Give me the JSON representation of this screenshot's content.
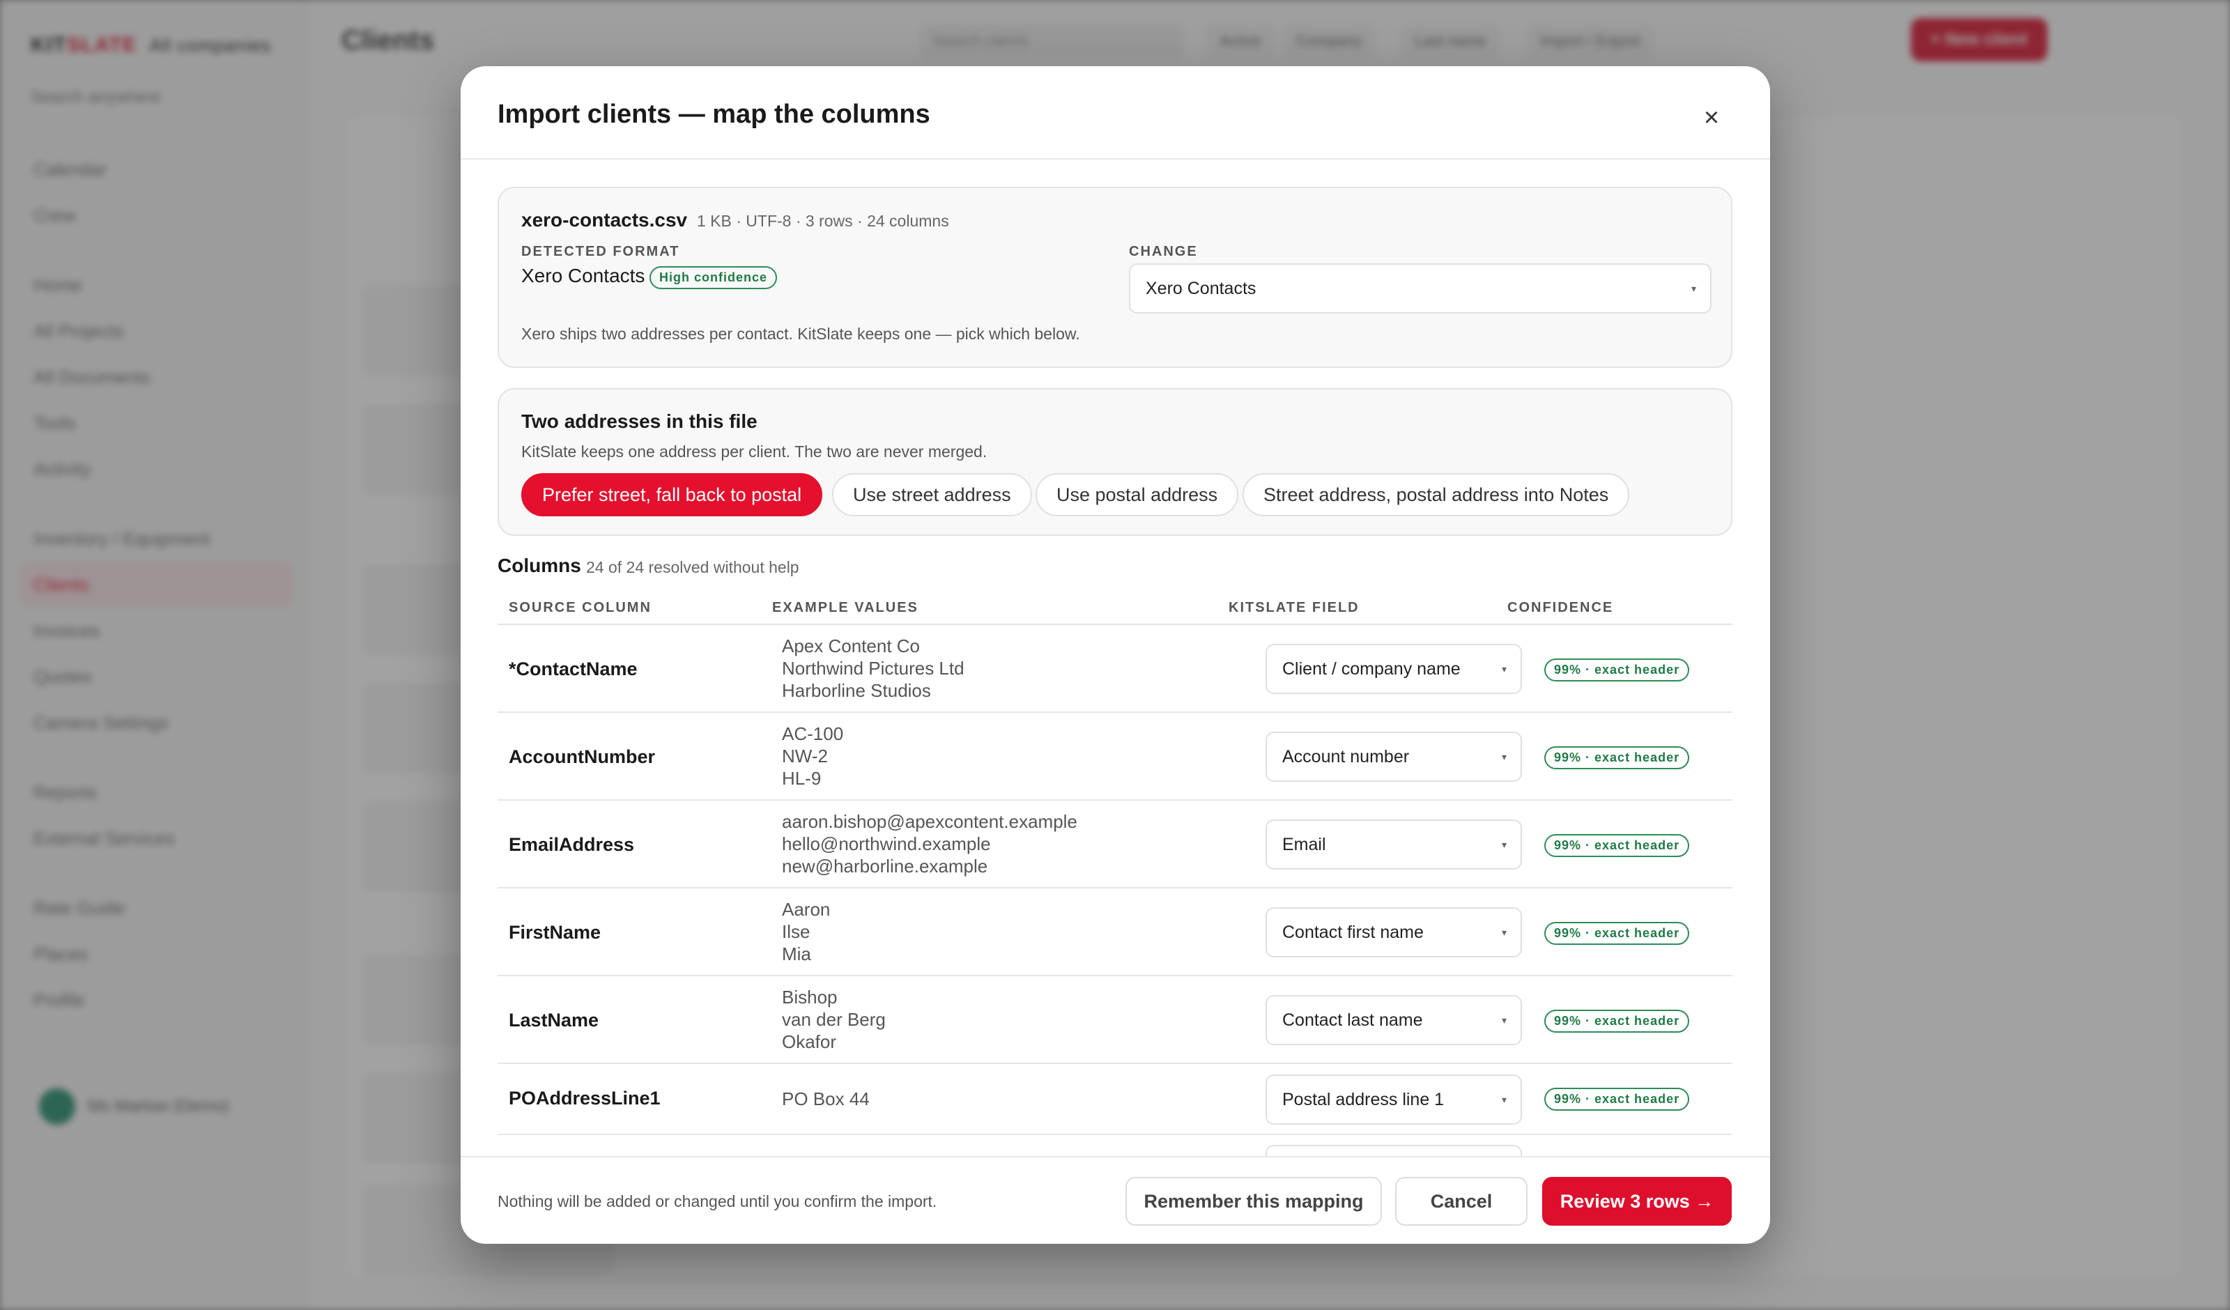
{
  "background": {
    "logo_a": "KIT",
    "logo_b": "SLATE",
    "company": "All companies",
    "search": "Search anywhere",
    "page_title": "Clients",
    "top_search": "Search clients",
    "top_buttons": [
      "Active",
      "Company",
      "Last name",
      "Import / Export"
    ],
    "new_button": "+ New client",
    "nav": [
      "Calendar",
      "Crew",
      "Home",
      "All Projects",
      "All Documents",
      "Tools",
      "Activity",
      "Inventory / Equipment",
      "Clients",
      "Invoices",
      "Quotes",
      "Camera Settings",
      "Reports",
      "External Services",
      "Rate Guide",
      "Places",
      "Profile"
    ],
    "user": "Ms Marlow (Demo)"
  },
  "modal": {
    "title": "Import clients — map the columns",
    "close": "×"
  },
  "file": {
    "name": "xero-contacts.csv",
    "meta": "1 KB · UTF-8 · 3 rows · 24 columns",
    "detected_label": "DETECTED FORMAT",
    "detected_value": "Xero Contacts",
    "confidence": "High confidence",
    "change_label": "CHANGE",
    "change_value": "Xero Contacts",
    "note": "Xero ships two addresses per contact. KitSlate keeps one — pick which below."
  },
  "addresses": {
    "title": "Two addresses in this file",
    "subtitle": "KitSlate keeps one address per client. The two are never merged.",
    "options": [
      "Prefer street, fall back to postal",
      "Use street address",
      "Use postal address",
      "Street address, postal address into Notes"
    ]
  },
  "columns": {
    "title": "Columns",
    "subtitle": "24 of 24 resolved without help",
    "headers": [
      "SOURCE COLUMN",
      "EXAMPLE VALUES",
      "KITSLATE FIELD",
      "CONFIDENCE"
    ],
    "rows": [
      {
        "source": "*ContactName",
        "examples": [
          "Apex Content Co",
          "Northwind Pictures Ltd",
          "Harborline Studios"
        ],
        "field": "Client / company name",
        "confidence": "99% · exact header"
      },
      {
        "source": "AccountNumber",
        "examples": [
          "AC-100",
          "NW-2",
          "HL-9"
        ],
        "field": "Account number",
        "confidence": "99% · exact header"
      },
      {
        "source": "EmailAddress",
        "examples": [
          "aaron.bishop@apexcontent.example",
          "hello@northwind.example",
          "new@harborline.example"
        ],
        "field": "Email",
        "confidence": "99% · exact header"
      },
      {
        "source": "FirstName",
        "examples": [
          "Aaron",
          "Ilse",
          "Mia"
        ],
        "field": "Contact first name",
        "confidence": "99% · exact header"
      },
      {
        "source": "LastName",
        "examples": [
          "Bishop",
          "van der Berg",
          "Okafor"
        ],
        "field": "Contact last name",
        "confidence": "99% · exact header"
      },
      {
        "source": "POAddressLine1",
        "examples": [
          "PO Box 44"
        ],
        "field": "Postal address line 1",
        "confidence": "99% · exact header"
      }
    ]
  },
  "footer": {
    "note": "Nothing will be added or changed until you confirm the import.",
    "remember": "Remember this mapping",
    "cancel": "Cancel",
    "review": "Review 3 rows →"
  },
  "colors": {
    "accent": "#dd0f2d",
    "confidence_green": "#1f7a45"
  },
  "icons": {
    "close": "close-icon",
    "dropdown": "chevron-down-icon"
  }
}
